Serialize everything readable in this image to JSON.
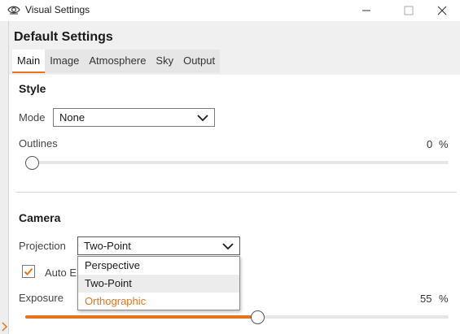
{
  "window": {
    "title": "Visual Settings",
    "app_icon": "eye-icon",
    "controls": [
      "minimize-icon",
      "maximize-icon",
      "close-icon"
    ]
  },
  "header": {
    "title": "Default Settings",
    "tabs": [
      {
        "label": "Main",
        "active": true
      },
      {
        "label": "Image",
        "active": false
      },
      {
        "label": "Atmosphere",
        "active": false
      },
      {
        "label": "Sky",
        "active": false
      },
      {
        "label": "Output",
        "active": false
      }
    ]
  },
  "style": {
    "heading": "Style",
    "mode_label": "Mode",
    "mode_value": "None",
    "outlines_label": "Outlines",
    "outlines_value": "0",
    "outlines_unit": "%",
    "outlines_level": 0
  },
  "camera": {
    "heading": "Camera",
    "projection_label": "Projection",
    "projection_value": "Two-Point",
    "projection_options": [
      "Perspective",
      "Two-Point",
      "Orthographic"
    ],
    "selected_option": "Two-Point",
    "hovered_option": "Orthographic",
    "auto_label": "Auto E",
    "auto_checked": true,
    "exposure_label": "Exposure",
    "exposure_value": "55",
    "exposure_unit": "%",
    "exposure_level": 0.55
  },
  "colors": {
    "accent": "#e8731a",
    "header_bg": "#f0f0f0",
    "tab_strip_bg": "#e6e6e6"
  }
}
